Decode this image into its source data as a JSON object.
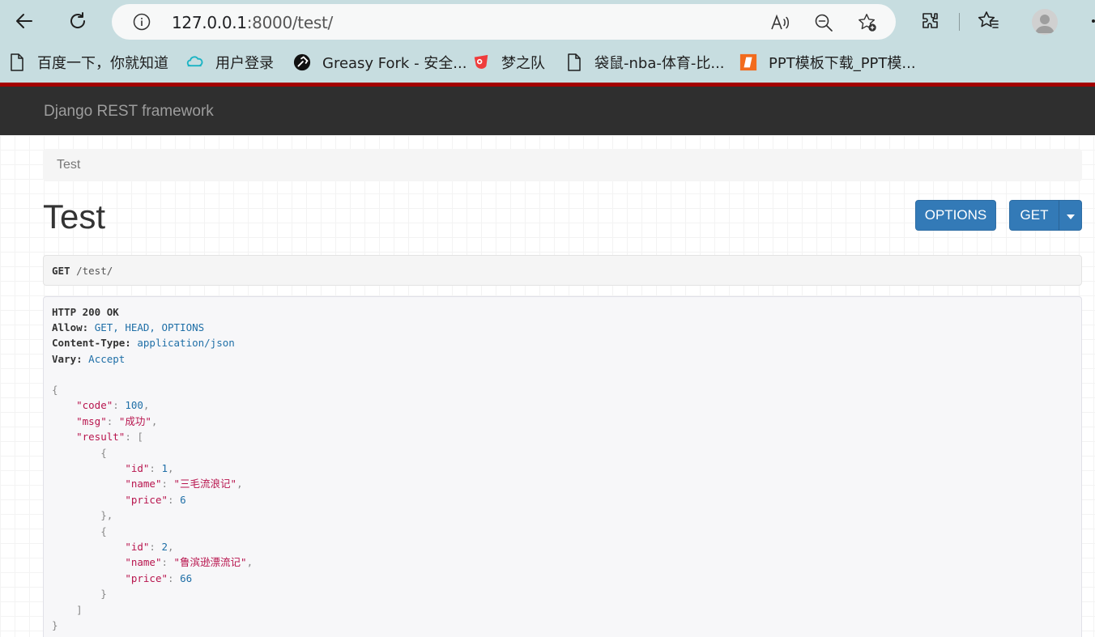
{
  "browser": {
    "url_host": "127.0.0.1",
    "url_rest": ":8000/test/",
    "icons": [
      "back-icon",
      "refresh-icon",
      "info-icon",
      "read-aloud-icon",
      "zoom-out-icon",
      "add-favorite-icon",
      "extensions-icon",
      "favorites-icon",
      "profile-avatar-icon",
      "more-icon"
    ]
  },
  "bookmarks": [
    {
      "label": "百度一下，你就知道",
      "icon": "page-icon"
    },
    {
      "label": "用户登录",
      "icon": "cloud-icon"
    },
    {
      "label": "Greasy Fork - 安全...",
      "icon": "greasyfork-icon"
    },
    {
      "label": "梦之队",
      "icon": "dreamteam-icon"
    },
    {
      "label": "袋鼠-nba-体育-比...",
      "icon": "page-icon"
    },
    {
      "label": "PPT模板下载_PPT模...",
      "icon": "ppt-icon"
    }
  ],
  "drf": {
    "brand": "Django REST framework",
    "breadcrumb": "Test",
    "title": "Test",
    "options_label": "OPTIONS",
    "get_label": "GET",
    "request_method": "GET",
    "request_path": "/test/"
  },
  "response": {
    "status": "HTTP 200 OK",
    "headers": [
      {
        "name": "Allow:",
        "value": "GET, HEAD, OPTIONS"
      },
      {
        "name": "Content-Type:",
        "value": "application/json"
      },
      {
        "name": "Vary:",
        "value": "Accept"
      }
    ],
    "body": {
      "code": "100",
      "msg": "\"成功\"",
      "result": [
        {
          "id": "1",
          "name": "\"三毛流浪记\"",
          "price": "6"
        },
        {
          "id": "2",
          "name": "\"鲁滨逊漂流记\"",
          "price": "66"
        }
      ]
    }
  },
  "colors": {
    "navbar": "#2f2f2f",
    "navbar_accent": "#a30000",
    "primary_button": "#337ab7",
    "browser_chrome": "#c7dde0"
  }
}
